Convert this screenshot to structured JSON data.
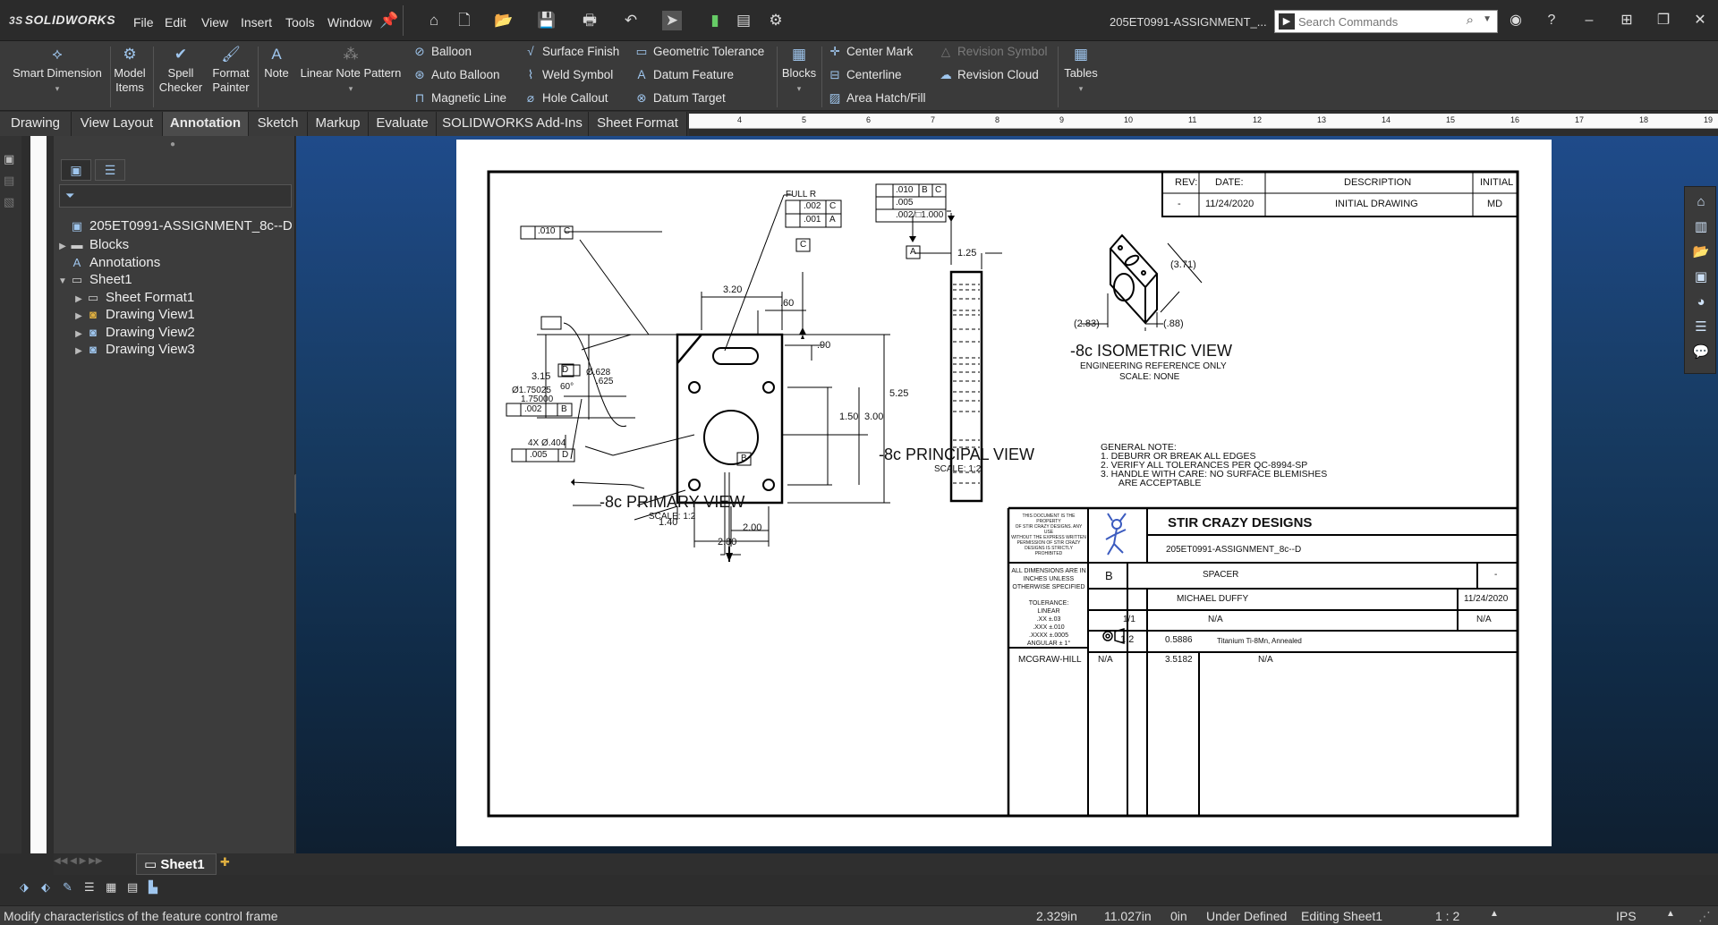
{
  "app": {
    "brand": "SOLIDWORKS",
    "document_title": "205ET0991-ASSIGNMENT_..."
  },
  "menu": [
    "File",
    "Edit",
    "View",
    "Insert",
    "Tools",
    "Window"
  ],
  "search": {
    "placeholder": "Search Commands"
  },
  "ribbon": {
    "smart_dimension": "Smart Dimension",
    "model_items": [
      "Model",
      "Items"
    ],
    "spell_checker": [
      "Spell",
      "Checker"
    ],
    "format_painter": [
      "Format",
      "Painter"
    ],
    "note": "Note",
    "linear_note_pattern": "Linear Note Pattern",
    "balloon": "Balloon",
    "auto_balloon": "Auto Balloon",
    "magnetic_line": "Magnetic Line",
    "surface_finish": "Surface Finish",
    "weld_symbol": "Weld Symbol",
    "hole_callout": "Hole Callout",
    "geometric_tolerance": "Geometric Tolerance",
    "datum_feature": "Datum Feature",
    "datum_target": "Datum Target",
    "blocks": "Blocks",
    "center_mark": "Center Mark",
    "centerline": "Centerline",
    "area_hatch": "Area Hatch/Fill",
    "revision_symbol": "Revision Symbol",
    "revision_cloud": "Revision Cloud",
    "tables": "Tables"
  },
  "command_tabs": [
    "Drawing",
    "View Layout",
    "Annotation",
    "Sketch",
    "Markup",
    "Evaluate",
    "SOLIDWORKS Add-Ins",
    "Sheet Format"
  ],
  "active_tab": "Annotation",
  "ruler_ticks": [
    "4",
    "5",
    "6",
    "7",
    "8",
    "9",
    "10",
    "11",
    "12",
    "13",
    "14",
    "15",
    "16",
    "17",
    "18",
    "19"
  ],
  "tree": {
    "root": "205ET0991-ASSIGNMENT_8c--D",
    "items": [
      "Blocks",
      "Annotations",
      "Sheet1",
      "Sheet Format1",
      "Drawing View1",
      "Drawing View2",
      "Drawing View3"
    ]
  },
  "sheet_tab": "Sheet1",
  "status": {
    "message": "Modify characteristics of the feature control frame",
    "x": "2.329in",
    "y": "11.027in",
    "z": "0in",
    "state": "Under Defined",
    "editing": "Editing Sheet1",
    "scale": "1 : 2",
    "units": "IPS"
  },
  "drawing": {
    "revision_table": {
      "headers": [
        "REV:",
        "DATE:",
        "DESCRIPTION",
        "INITIAL"
      ],
      "row": [
        "-",
        "11/24/2020",
        "INITIAL DRAWING",
        "MD"
      ]
    },
    "primary_view": {
      "title": "-8c PRIMARY VIEW",
      "scale": "SCALE: 1:2"
    },
    "principal_view": {
      "title": "-8c PRINCIPAL VIEW",
      "scale": "SCALE: 1:2"
    },
    "isometric_view": {
      "title": "-8c ISOMETRIC VIEW",
      "sub1": "ENGINEERING REFERENCE ONLY",
      "sub2": "SCALE: NONE"
    },
    "dims": {
      "d320": "3.20",
      "d60": ".60",
      "d90": ".90",
      "d315": "3.15",
      "d628": "Ø.628",
      "d625": ".625",
      "d60deg": "60°",
      "d150": "1.50",
      "d300": "3.00",
      "d525": "5.25",
      "d140": "1.40",
      "d200": "2.00",
      "d280": "2.80",
      "d175a": "Ø1.75025",
      "d175b": "1.75000",
      "d404": "4X Ø.404",
      "d125": "1.25",
      "iso371": "(3.71)",
      "iso283": "(2.83)",
      "iso88": "(.88)",
      "full_r": "FULL R"
    },
    "fcf": {
      "angularity": ".010",
      "datum_c": "C",
      "par002": ".002",
      "perp001": ".001",
      "datum_a": "A",
      "perp002": ".002",
      "datum_b": "B",
      "par005": ".005",
      "datum_d": "D",
      "pos010": ".010",
      "flat005": ".005",
      "flat002": ".002/□1.000"
    },
    "general_note": {
      "title": "GENERAL NOTE:",
      "lines": [
        "1.    DEBURR OR BREAK ALL EDGES",
        "2.    VERIFY ALL TOLERANCES PER QC-8994-SP",
        "3.    HANDLE WITH CARE: NO SURFACE BLEMISHES",
        "       ARE ACCEPTABLE"
      ]
    },
    "title_block": {
      "company": "STIR CRAZY DESIGNS",
      "drawing_no": "205ET0991-ASSIGNMENT_8c--D",
      "size": "B",
      "title": "SPACER",
      "rev": "-",
      "drawn_by": "MICHAEL DUFFY",
      "date": "11/24/2020",
      "sheet": "1/1",
      "checked_by": "N/A",
      "checked_date": "N/A",
      "scale": "1:2",
      "volume": "0.5886",
      "material": "Titanium Ti-8Mn, Annealed",
      "designed_for": "MCGRAW-HILL",
      "assembly": "N/A",
      "weight": "3.5182",
      "next": "N/A",
      "property_note": [
        "THIS DOCUMENT IS THE PROPERTY",
        "OF STIR CRAZY DESIGNS. ANY USE",
        "WITHOUT THE EXPRESS WRITTEN",
        "PERMISSION OF STIR CRAZY",
        "DESIGNS IS STRICTLY PROHIBITED"
      ],
      "tolerance_note": [
        "ALL DIMENSIONS ARE IN",
        "INCHES UNLESS",
        "OTHERWISE SPECIFIED",
        "",
        "TOLERANCE:",
        "LINEAR",
        ".XX ±.03",
        ".XXX ±.010",
        ".XXXX ±.0005",
        "ANGULAR ± 1°"
      ]
    }
  },
  "colors": {
    "accent": "#9fc6ee",
    "background_top": "#1f4b8a",
    "background_bottom": "#0f1f30"
  }
}
